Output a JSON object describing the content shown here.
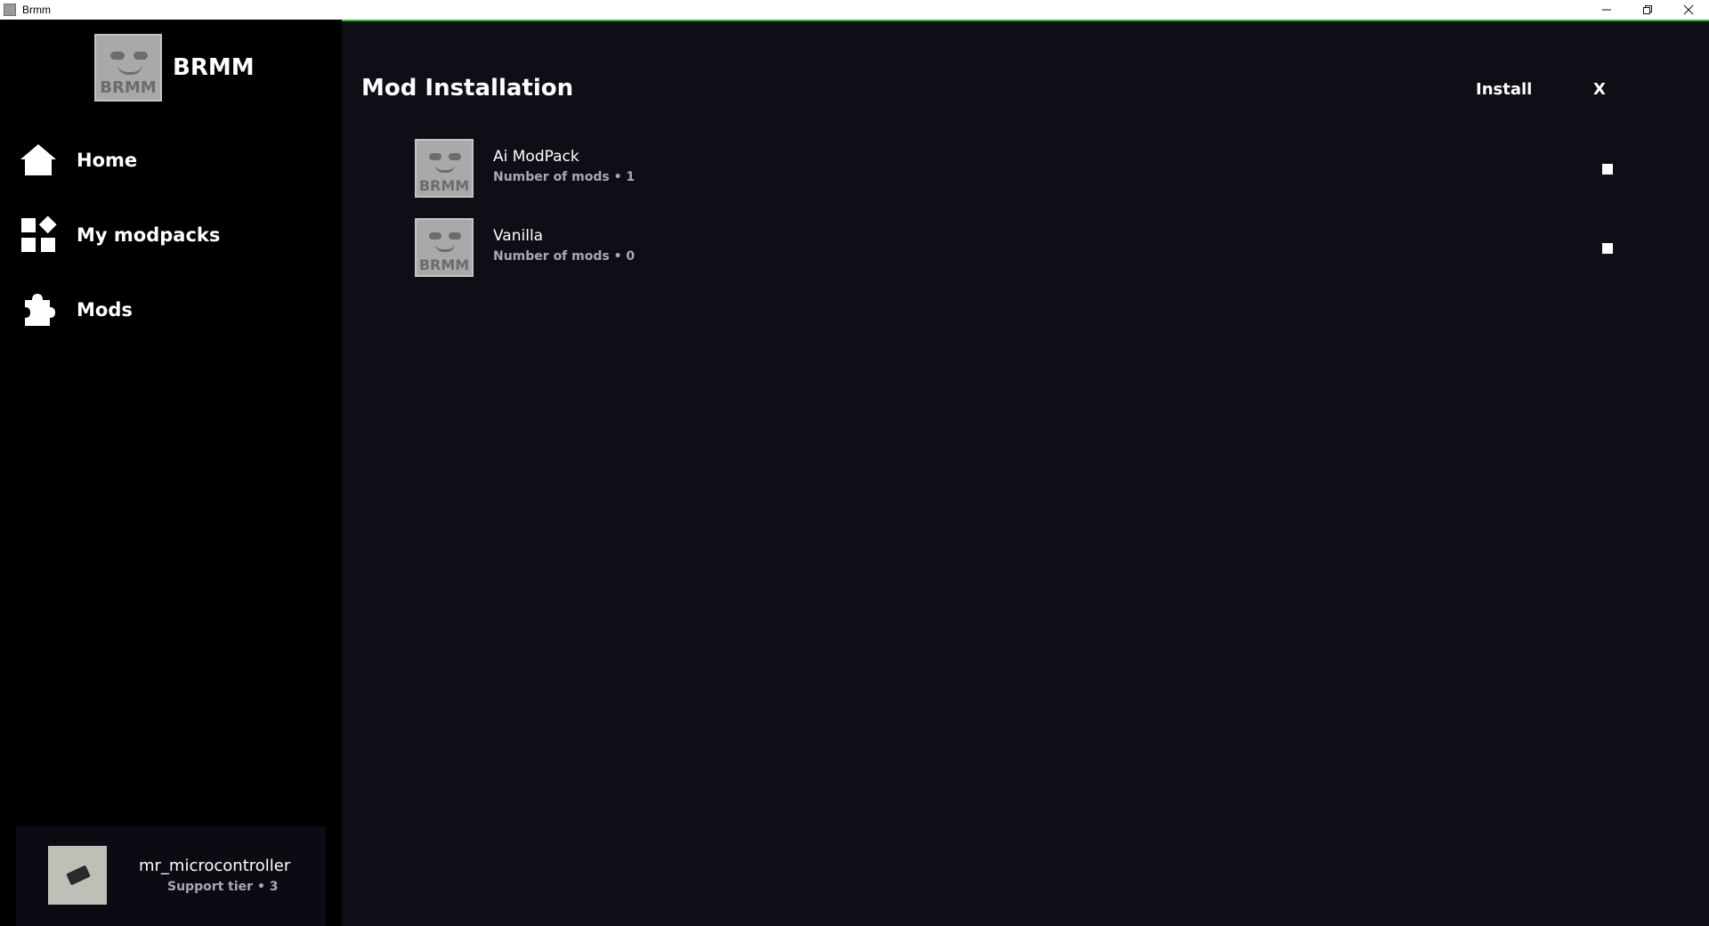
{
  "window": {
    "title": "Brmm",
    "controls": [
      "minimize",
      "restore",
      "close"
    ]
  },
  "brand": {
    "logo_text": "BRMM",
    "name": "BRMM"
  },
  "nav": {
    "items": [
      {
        "label": "Home",
        "icon": "home-icon"
      },
      {
        "label": "My modpacks",
        "icon": "widgets-icon"
      },
      {
        "label": "Mods",
        "icon": "puzzle-icon"
      }
    ]
  },
  "user": {
    "name": "mr_microcontroller",
    "tier": "Support tier • 3"
  },
  "main": {
    "title": "Mod Installation",
    "install_label": "Install",
    "close_label": "X",
    "progress_color": "#22c22b",
    "packs": [
      {
        "name": "Ai ModPack",
        "meta": "Number of mods • 1",
        "thumb_text": "BRMM",
        "checked": false
      },
      {
        "name": "Vanilla",
        "meta": "Number of mods • 0",
        "thumb_text": "BRMM",
        "checked": false
      }
    ]
  }
}
